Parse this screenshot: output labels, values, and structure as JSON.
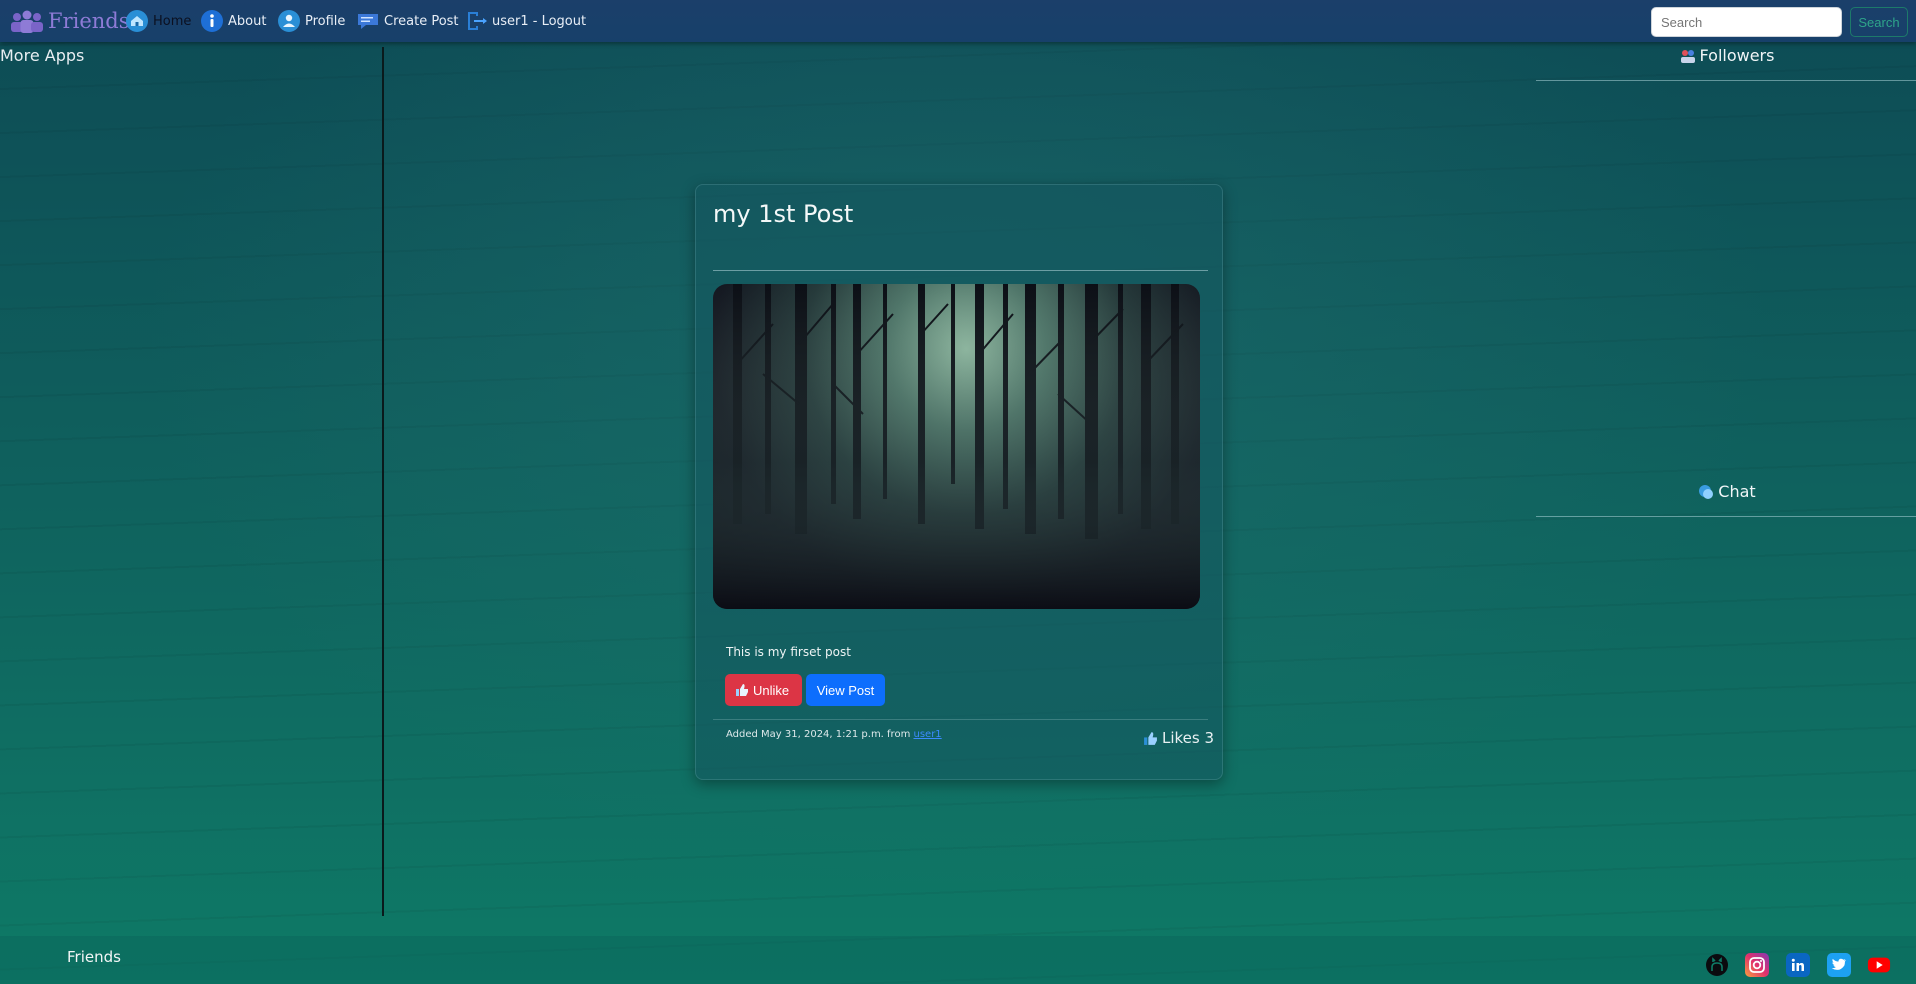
{
  "navbar": {
    "brand": "Friends",
    "items": [
      {
        "label": "Home",
        "icon": "home-icon"
      },
      {
        "label": "About",
        "icon": "info-icon"
      },
      {
        "label": "Profile",
        "icon": "user-icon"
      },
      {
        "label": "Create Post",
        "icon": "chat-bubble-icon"
      },
      {
        "label": "user1 - Logout",
        "icon": "logout-icon"
      }
    ],
    "search_placeholder": "Search",
    "search_button": "Search"
  },
  "left": {
    "more_apps": "More Apps"
  },
  "right": {
    "followers": "Followers",
    "chat": "Chat"
  },
  "post": {
    "title": "my 1st Post",
    "text": "This is my firset post",
    "unlike_label": "Unlike",
    "view_label": "View Post",
    "meta_prefix": "Added May 31, 2024, 1:21 p.m. from",
    "author": "user1",
    "likes": "Likes 3"
  },
  "footer": {
    "brand": "Friends",
    "socials": [
      "github-icon",
      "instagram-icon",
      "linkedin-icon",
      "twitter-icon",
      "youtube-icon"
    ]
  },
  "colors": {
    "navbar": "#1b3f6a",
    "unlike": "#dc3545",
    "view": "#0d6efd",
    "link": "#3b8bff"
  }
}
